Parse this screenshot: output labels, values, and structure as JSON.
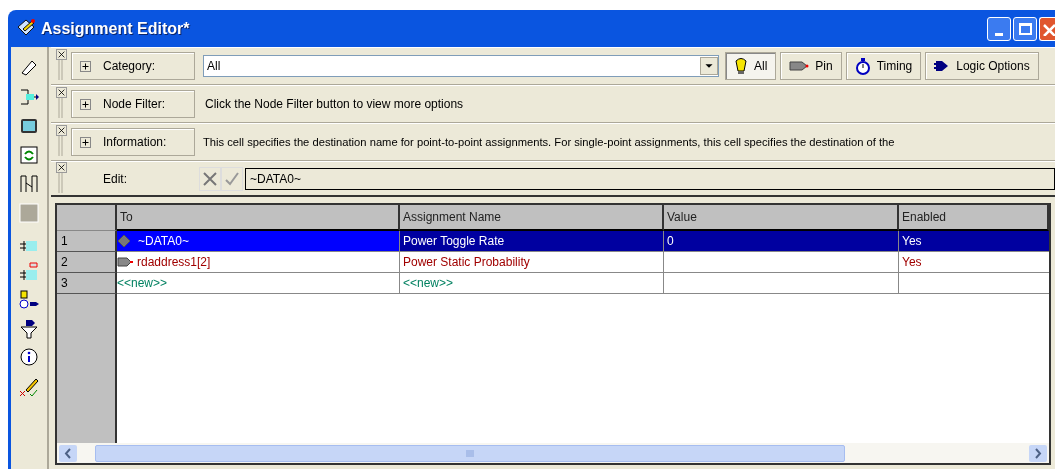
{
  "window": {
    "title": "Assignment Editor*"
  },
  "category": {
    "label": "Category:",
    "value": "All"
  },
  "filter_buttons": [
    {
      "kind": "all",
      "label": "All",
      "selected": true
    },
    {
      "kind": "pin",
      "label": "Pin",
      "selected": false
    },
    {
      "kind": "timing",
      "label": "Timing",
      "selected": false
    },
    {
      "kind": "logic",
      "label": "Logic Options",
      "selected": false
    }
  ],
  "node_filter": {
    "label": "Node Filter:",
    "text": "Click the Node Filter button to view more options"
  },
  "information": {
    "label": "Information:",
    "text": "This cell specifies the destination name for point-to-point assignments. For single-point assignments, this cell specifies the destination of the"
  },
  "edit": {
    "label": "Edit:",
    "value": "~DATA0~"
  },
  "table": {
    "columns": [
      "To",
      "Assignment Name",
      "Value",
      "Enabled"
    ],
    "rows": [
      {
        "number": "1",
        "kind": "node",
        "to": "~DATA0~",
        "assignment_name": "Power Toggle Rate",
        "value": "0",
        "enabled": "Yes",
        "selected": true
      },
      {
        "number": "2",
        "kind": "pin",
        "to": "rdaddress1[2]",
        "assignment_name": "Power Static Probability",
        "enabled": "Yes",
        "selected": false
      },
      {
        "number": "3",
        "kind": "new",
        "to": "<<new>>",
        "assignment_name": "<<new>>",
        "selected": false
      }
    ]
  }
}
